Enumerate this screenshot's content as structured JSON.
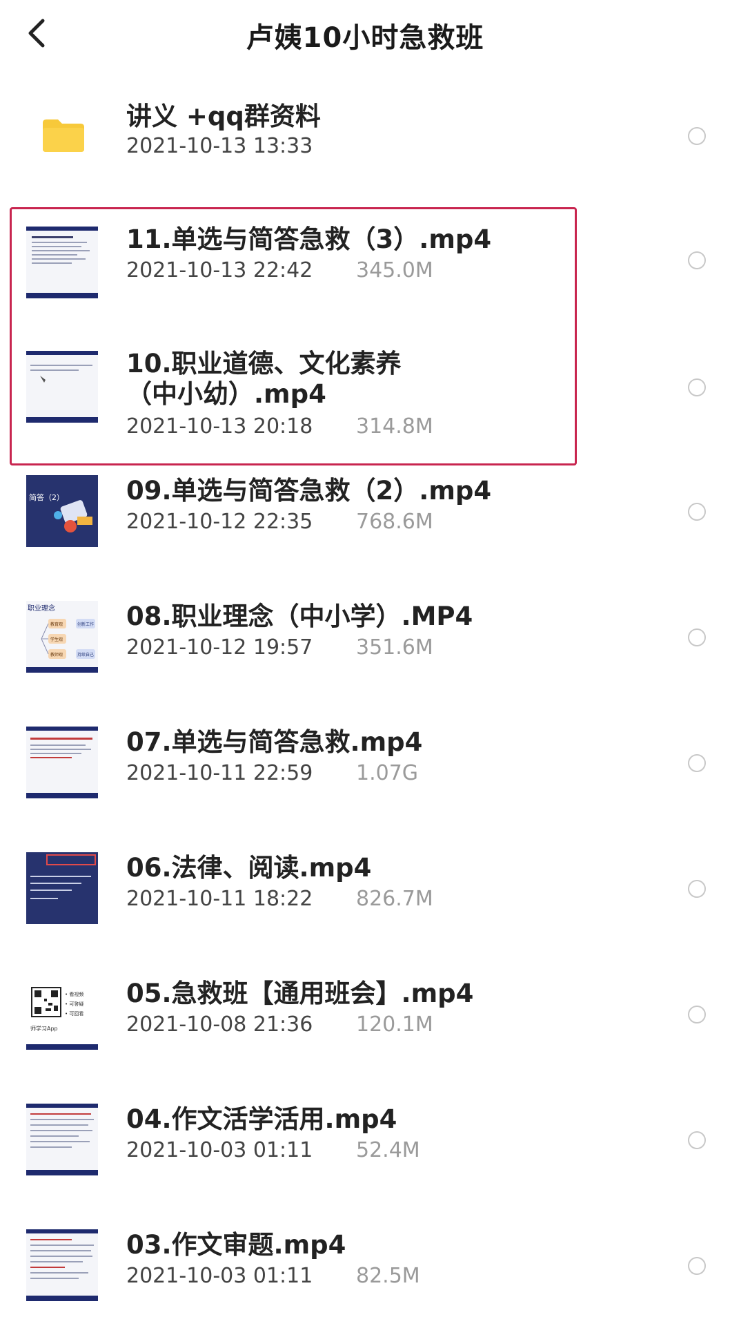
{
  "header": {
    "title": "卢姨10小时急救班",
    "back_icon": "chevron-left-icon"
  },
  "colors": {
    "highlight_border": "#c8254f",
    "folder": "#f7c93a",
    "size_text": "#9a9a9a",
    "thumb_frame": "#1e2a6e"
  },
  "folder": {
    "name": "讲义 +qq群资料",
    "date": "2021-10-13 13:33",
    "icon": "folder-icon"
  },
  "files": [
    {
      "name_line1": "11.单选与简答急救（3）.mp4",
      "name_line2": "",
      "date": "2021-10-13 22:42",
      "size": "345.0M"
    },
    {
      "name_line1": "10.职业道德、文化素养",
      "name_line2": "（中小幼）.mp4",
      "date": "2021-10-13 20:18",
      "size": "314.8M"
    },
    {
      "name_line1": "09.单选与简答急救（2）.mp4",
      "name_line2": "",
      "date": "2021-10-12 22:35",
      "size": "768.6M"
    },
    {
      "name_line1": "08.职业理念（中小学）.MP4",
      "name_line2": "",
      "date": "2021-10-12 19:57",
      "size": "351.6M"
    },
    {
      "name_line1": "07.单选与简答急救.mp4",
      "name_line2": "",
      "date": "2021-10-11 22:59",
      "size": "1.07G"
    },
    {
      "name_line1": "06.法律、阅读.mp4",
      "name_line2": "",
      "date": "2021-10-11 18:22",
      "size": "826.7M"
    },
    {
      "name_line1": "05.急救班【通用班会】.mp4",
      "name_line2": "",
      "date": "2021-10-08 21:36",
      "size": "120.1M"
    },
    {
      "name_line1": "04.作文活学活用.mp4",
      "name_line2": "",
      "date": "2021-10-03 01:11",
      "size": "52.4M"
    },
    {
      "name_line1": "03.作文审题.mp4",
      "name_line2": "",
      "date": "2021-10-03 01:11",
      "size": "82.5M"
    }
  ],
  "thumbnail_text": {
    "t09": "简答（2）",
    "t08_title": "职业理念",
    "t08_nodes": [
      "教育观",
      "学生观",
      "教师观",
      "创新工作",
      "持续自己"
    ],
    "t05_items": [
      "• 看视频",
      "• 可答疑",
      "• 可回看"
    ],
    "t05_caption": "师学习App"
  }
}
